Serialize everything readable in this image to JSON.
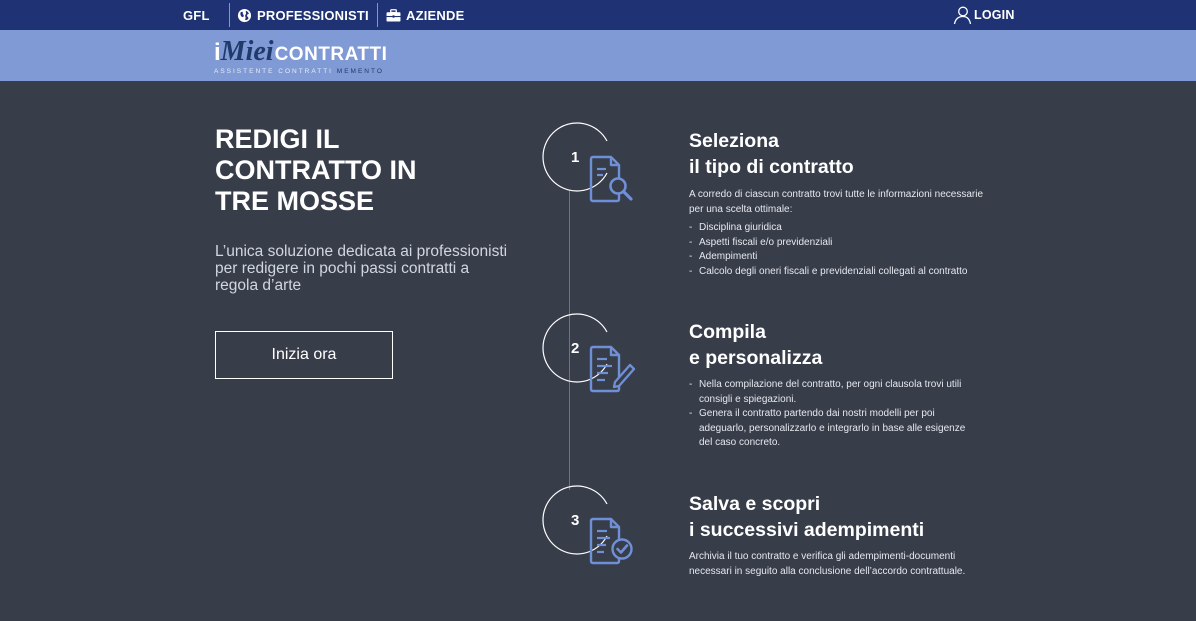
{
  "nav": {
    "gfl": "GFL",
    "professionisti": "PROFESSIONISTI",
    "aziende": "AZIENDE",
    "login": "LOGIN",
    "icons": {
      "professionisti": "globe-icon",
      "aziende": "briefcase-icon",
      "login": "user-icon"
    }
  },
  "brand": {
    "logo_i": "i",
    "logo_miei": "Miei",
    "logo_contratti": "CONTRATTI",
    "tagline_prefix": "ASSISTENTE CONTRATTI",
    "tagline_memento": "MEMENTO"
  },
  "hero": {
    "title_line1": "REDIGI IL",
    "title_line2": "CONTRATTO IN",
    "title_line3": "TRE MOSSE",
    "subtitle": "L’unica soluzione dedicata ai professionisti per redigere in pochi passi contratti a regola d’arte",
    "cta_label": "Inizia ora"
  },
  "steps": [
    {
      "number": "1",
      "icon": "document-search-icon",
      "title_line1": "Seleziona",
      "title_line2": "il tipo di contratto",
      "intro": "A corredo di ciascun contratto trovi tutte le informazioni necessarie per una scelta ottimale:",
      "bullets": [
        "Disciplina giuridica",
        "Aspetti fiscali e/o previdenziali",
        "Adempimenti",
        "Calcolo degli oneri fiscali e previdenziali collegati al contratto"
      ]
    },
    {
      "number": "2",
      "icon": "document-edit-icon",
      "title_line1": "Compila",
      "title_line2": "e personalizza",
      "bullets": [
        "Nella compilazione del contratto, per ogni clausola trovi utili consigli e spiegazioni.",
        "Genera il contratto partendo dai nostri modelli per poi adeguarlo, personalizzarlo e integrarlo in base alle esigenze del caso concreto."
      ]
    },
    {
      "number": "3",
      "icon": "document-check-icon",
      "title_line1": "Salva e scopri",
      "title_line2": "i successivi adempimenti",
      "text": "Archivia il tuo contratto e verifica gli adempimenti-documenti necessari in seguito alla conclusione dell’accordo contrattuale."
    }
  ],
  "colors": {
    "topbar": "#1f3273",
    "brandbar": "#7f9ad4",
    "background": "#383d4a",
    "icon_blue": "#6f8fd6"
  }
}
